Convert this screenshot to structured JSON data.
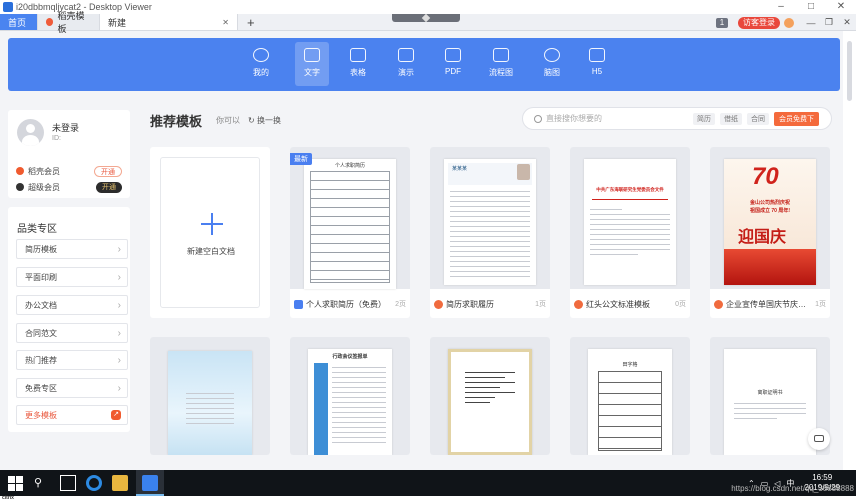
{
  "window": {
    "title": "i20dbbmqljycat2 - Desktop Viewer",
    "controls": [
      "–",
      "□",
      "✕"
    ]
  },
  "tabs": [
    {
      "label": "首页",
      "icon": "home-icon"
    },
    {
      "label": "稻壳模板",
      "icon": "daoke-logo-icon"
    },
    {
      "label": "新建",
      "close": "✕"
    }
  ],
  "tabs_right": {
    "badge": "1",
    "visitor_label": "访客登录",
    "window_controls": [
      "—",
      "❐",
      "✕"
    ]
  },
  "tools": [
    {
      "label": "我的",
      "icon": "star-icon"
    },
    {
      "label": "文字",
      "icon": "document-icon",
      "active": true
    },
    {
      "label": "表格",
      "icon": "table-icon"
    },
    {
      "label": "演示",
      "icon": "presentation-icon"
    },
    {
      "label": "PDF",
      "icon": "pdf-icon"
    },
    {
      "label": "流程图",
      "icon": "flowchart-icon"
    },
    {
      "label": "脑图",
      "icon": "mindmap-icon"
    },
    {
      "label": "H5",
      "icon": "h5-icon"
    }
  ],
  "user": {
    "name": "未登录",
    "id": "ID:",
    "members": [
      {
        "label": "稻壳会员",
        "action": "开通",
        "style": "outline"
      },
      {
        "label": "超级会员",
        "action": "开通",
        "style": "dark"
      }
    ]
  },
  "categories": {
    "title": "品类专区",
    "items": [
      "简历模板",
      "平面印刷",
      "办公文档",
      "合同范文",
      "热门推荐",
      "免费专区",
      "更多模板"
    ]
  },
  "main": {
    "title": "推荐模板",
    "maybe": "你可以",
    "switch": "换一换",
    "search_placeholder": "直接搜你想要的",
    "search_tags": [
      "简历",
      "借纸",
      "合同"
    ],
    "search_free": "会员免费下",
    "blank_label": "新建空白文档",
    "newest_badge": "最新",
    "templates_row1": [
      {
        "name": "个人求职简历（免费）",
        "pages": "2页",
        "icon_style": "blue"
      },
      {
        "name": "简历求职履历",
        "pages": "1页",
        "icon_style": "orange"
      },
      {
        "name": "红头公文标准模板",
        "pages": "0页",
        "icon_style": "orange"
      },
      {
        "name": "企业宣传单国庆节庆…",
        "pages": "1页",
        "icon_style": "orange"
      }
    ],
    "thumb_texts": {
      "resume_form_title": "个人求职简历",
      "resume_name": "某某某",
      "redhead_title": "中共广东海联研究生党委员会文件",
      "poster_headline1": "金山公司热烈庆祝",
      "poster_headline2": "祖国成立 70 周年!",
      "poster_big": "迎国庆",
      "poster_70": "70",
      "meeting_title": "行政会议签报单",
      "tianzi_title": "田字格",
      "letter_title": "离职证明书"
    }
  },
  "taskbar": {
    "time": "16:59",
    "date": "2019/9/29",
    "ime": "中",
    "tray_icons": [
      "chevron-up-icon",
      "network-icon",
      "volume-icon"
    ]
  },
  "citrix_logo": "citrix",
  "watermark": "https://blog.csdn.net/qq_38888888"
}
